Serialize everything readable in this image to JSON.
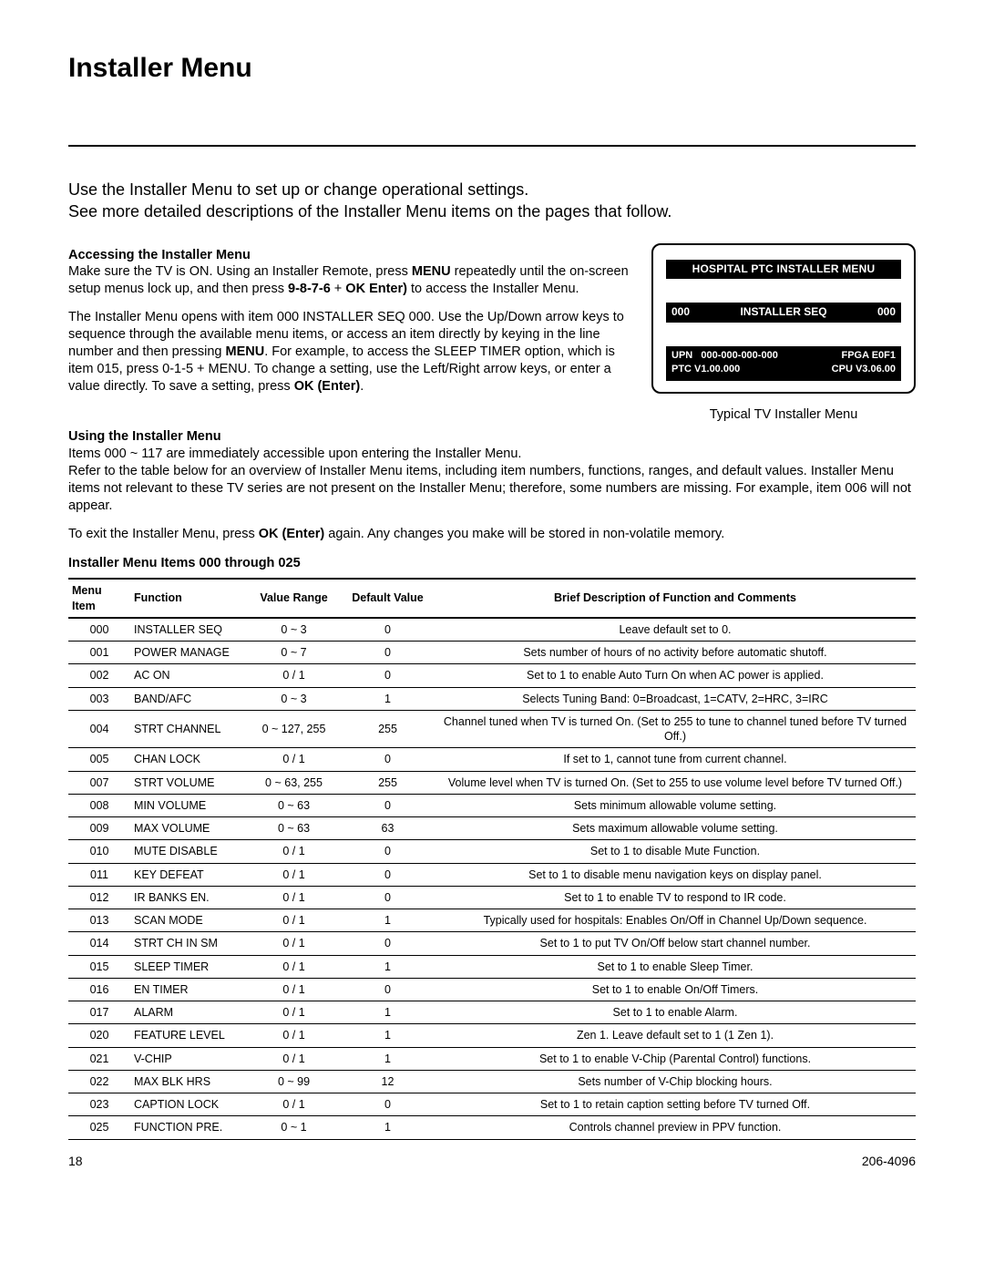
{
  "title": "Installer Menu",
  "intro1": "Use the Installer Menu to set up or change operational settings.",
  "intro2": "See more detailed descriptions of the Installer Menu items on the pages that follow.",
  "accessing": {
    "heading": "Accessing the Installer Menu",
    "p1a": "Make sure the TV is ON. Using an Installer Remote, press ",
    "p1b": "MENU",
    "p1c": " repeatedly until the on-screen setup menus lock up, and then press ",
    "p1d": "9-8-7-6",
    "p1e": " + ",
    "p1f": "OK Enter)",
    "p1g": " to access the Installer Menu.",
    "p2a": "The Installer Menu opens with item 000 INSTALLER SEQ 000. Use the Up/Down arrow keys to sequence through the available menu items, or access an item directly by keying in the line number and then pressing ",
    "p2b": "MENU",
    "p2c": ". For example, to access the SLEEP TIMER option, which is item 015, press 0-1-5 + MENU. To change a setting, use the Left/Right arrow keys, or enter a value directly. To save a setting, press ",
    "p2d": "OK (Enter)",
    "p2e": "."
  },
  "using": {
    "heading": "Using the Installer Menu",
    "p1": "Items 000 ~ 117 are immediately accessible upon entering the Installer Menu.",
    "p2": "Refer to the table below for an overview of Installer Menu items, including item numbers, functions, ranges, and default values. Installer Menu items not relevant to these TV series are not present on the Installer Menu; therefore, some numbers are missing. For example, item 006 will not appear.",
    "p3a": "To exit the Installer Menu, press ",
    "p3b": "OK (Enter)",
    "p3c": " again. Any changes you make will be stored in non-volatile memory."
  },
  "tv": {
    "title": "HOSPITAL PTC INSTALLER MENU",
    "mid_left": "000",
    "mid_center": "INSTALLER SEQ",
    "mid_right": "000",
    "upn_label": "UPN",
    "upn_val": "000-000-000-000",
    "fpga": "FPGA E0F1",
    "ptc": "PTC V1.00.000",
    "cpu": "CPU V3.06.00",
    "caption": "Typical TV Installer Menu"
  },
  "table": {
    "heading": "Installer Menu Items 000 through 025",
    "headers": {
      "item": "Menu Item",
      "func": "Function",
      "range": "Value Range",
      "def": "Default Value",
      "desc": "Brief Description of Function and Comments"
    },
    "rows": [
      {
        "item": "000",
        "func": "INSTALLER SEQ",
        "range": "0 ~ 3",
        "def": "0",
        "desc": "Leave default set to 0."
      },
      {
        "item": "001",
        "func": "POWER MANAGE",
        "range": "0 ~ 7",
        "def": "0",
        "desc": "Sets number of hours of no activity before automatic shutoff."
      },
      {
        "item": "002",
        "func": "AC ON",
        "range": "0 / 1",
        "def": "0",
        "desc": "Set to 1 to enable Auto Turn On when AC power is applied."
      },
      {
        "item": "003",
        "func": "BAND/AFC",
        "range": "0 ~ 3",
        "def": "1",
        "desc": "Selects Tuning Band: 0=Broadcast, 1=CATV, 2=HRC, 3=IRC"
      },
      {
        "item": "004",
        "func": "STRT CHANNEL",
        "range": "0 ~ 127, 255",
        "def": "255",
        "desc": "Channel tuned when TV is turned On. (Set to 255 to tune to channel tuned before TV turned Off.)"
      },
      {
        "item": "005",
        "func": "CHAN LOCK",
        "range": "0 / 1",
        "def": "0",
        "desc": "If set to 1, cannot tune from current channel."
      },
      {
        "item": "007",
        "func": "STRT VOLUME",
        "range": "0 ~ 63, 255",
        "def": "255",
        "desc": "Volume level when TV is turned On. (Set to 255 to use volume level before TV turned Off.)"
      },
      {
        "item": "008",
        "func": "MIN VOLUME",
        "range": "0 ~ 63",
        "def": "0",
        "desc": "Sets minimum allowable volume setting."
      },
      {
        "item": "009",
        "func": "MAX VOLUME",
        "range": "0 ~ 63",
        "def": "63",
        "desc": "Sets maximum allowable volume setting."
      },
      {
        "item": "010",
        "func": "MUTE DISABLE",
        "range": "0 / 1",
        "def": "0",
        "desc": "Set to 1 to disable Mute Function."
      },
      {
        "item": "011",
        "func": "KEY DEFEAT",
        "range": "0 / 1",
        "def": "0",
        "desc": "Set to 1 to disable menu navigation keys on display panel."
      },
      {
        "item": "012",
        "func": "IR BANKS EN.",
        "range": "0 / 1",
        "def": "0",
        "desc": "Set to 1 to enable TV to respond to IR code."
      },
      {
        "item": "013",
        "func": "SCAN MODE",
        "range": "0 / 1",
        "def": "1",
        "desc": "Typically used for hospitals: Enables On/Off in Channel Up/Down sequence."
      },
      {
        "item": "014",
        "func": "STRT CH IN SM",
        "range": "0 / 1",
        "def": "0",
        "desc": "Set to 1 to put TV On/Off below start channel number."
      },
      {
        "item": "015",
        "func": "SLEEP TIMER",
        "range": "0 / 1",
        "def": "1",
        "desc": "Set to 1 to enable Sleep Timer."
      },
      {
        "item": "016",
        "func": "EN TIMER",
        "range": "0 / 1",
        "def": "0",
        "desc": "Set to 1 to enable On/Off Timers."
      },
      {
        "item": "017",
        "func": "ALARM",
        "range": "0 / 1",
        "def": "1",
        "desc": "Set to 1 to enable Alarm."
      },
      {
        "item": "020",
        "func": "FEATURE LEVEL",
        "range": "0 / 1",
        "def": "1",
        "desc": "Zen 1. Leave default set to 1 (1 Zen 1)."
      },
      {
        "item": "021",
        "func": "V-CHIP",
        "range": "0 / 1",
        "def": "1",
        "desc": "Set to 1 to enable V-Chip (Parental Control) functions."
      },
      {
        "item": "022",
        "func": "MAX BLK HRS",
        "range": "0 ~ 99",
        "def": "12",
        "desc": "Sets number of V-Chip blocking hours."
      },
      {
        "item": "023",
        "func": "CAPTION LOCK",
        "range": "0 / 1",
        "def": "0",
        "desc": "Set to 1 to retain caption setting before TV turned Off."
      },
      {
        "item": "025",
        "func": "FUNCTION PRE.",
        "range": "0 ~ 1",
        "def": "1",
        "desc": "Controls channel preview in PPV function."
      }
    ]
  },
  "footer": {
    "page": "18",
    "doc": "206-4096"
  }
}
